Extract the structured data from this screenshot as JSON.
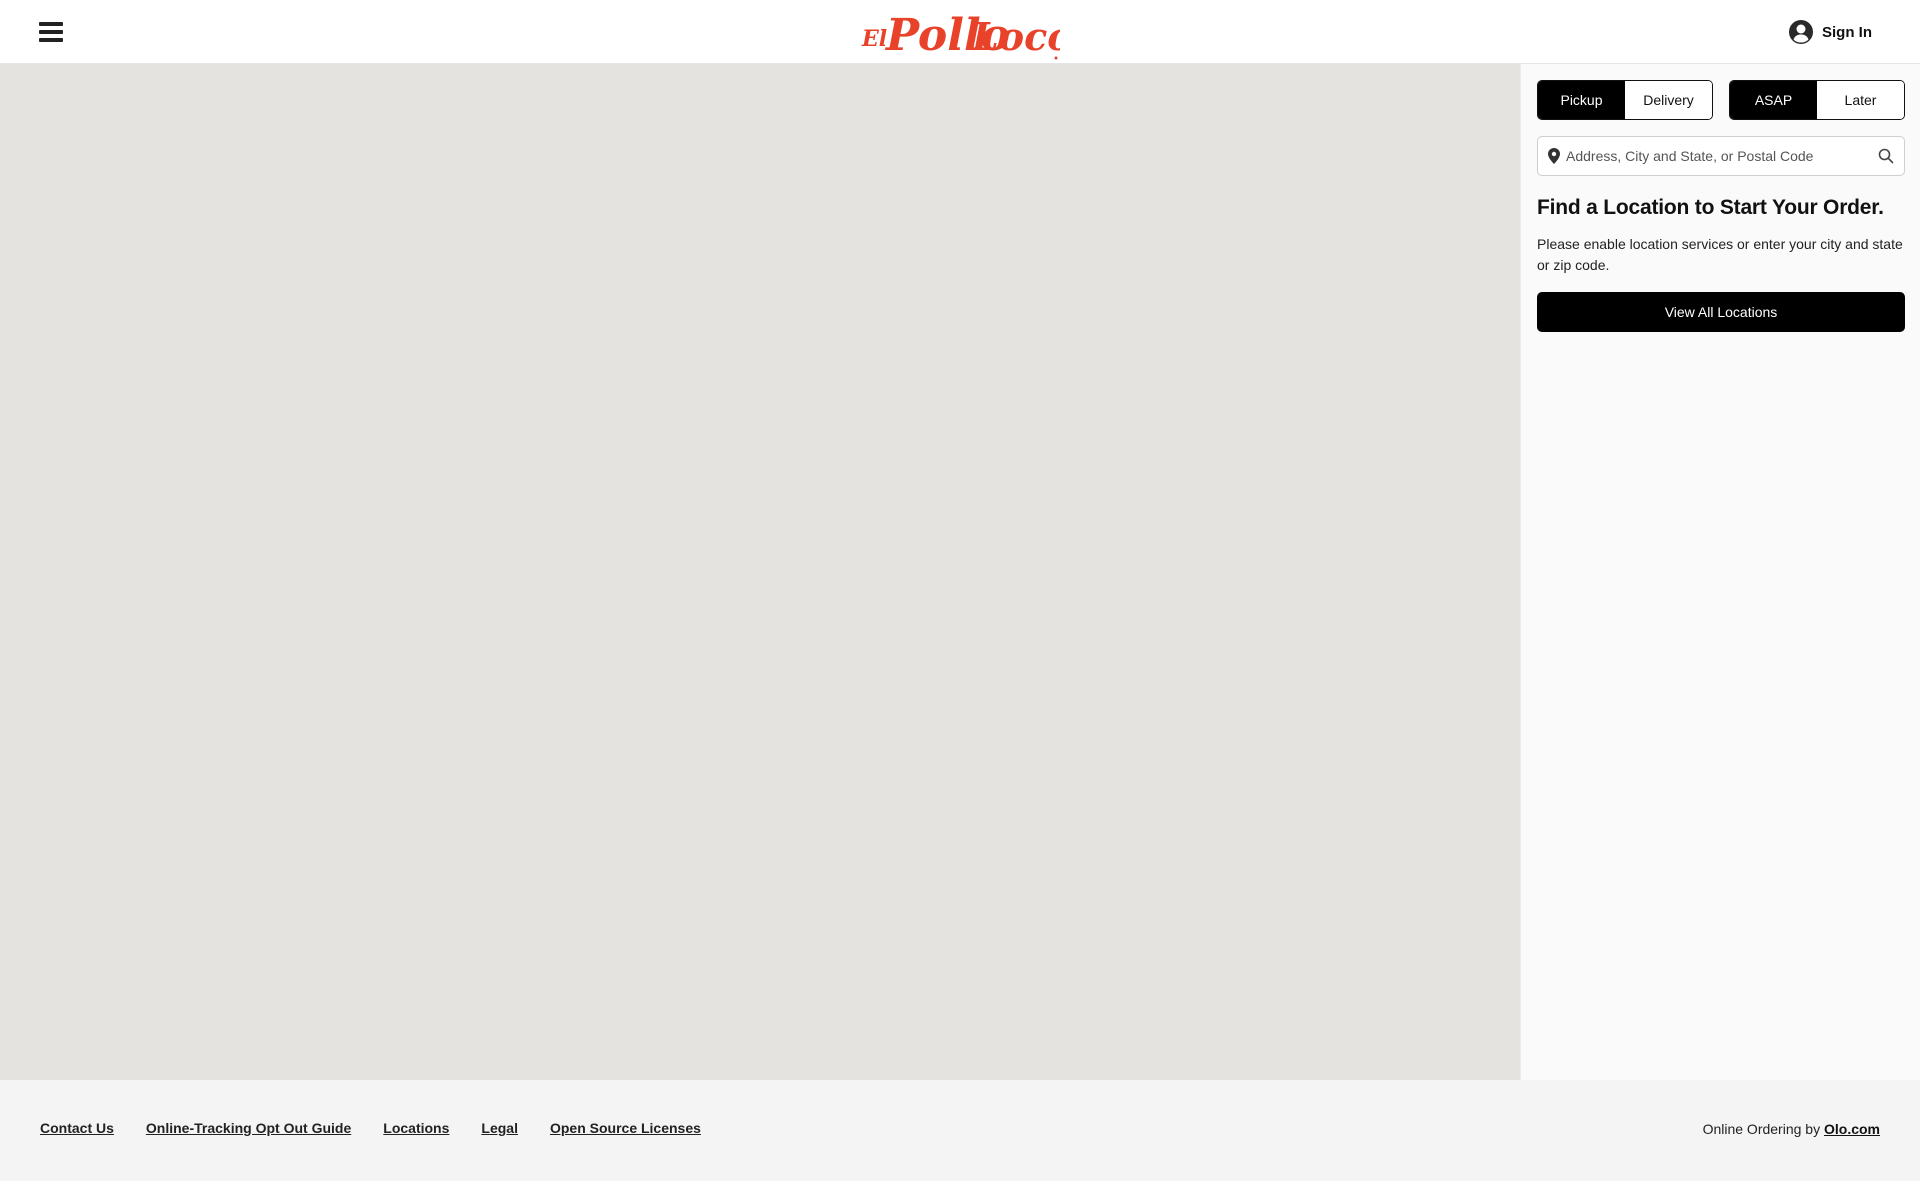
{
  "header": {
    "menu_icon": "hamburger-menu-icon",
    "logo_text": "El Pollo Loco",
    "signin_label": "Sign In",
    "signin_icon": "user-circle-icon"
  },
  "panel": {
    "mode_options": [
      {
        "label": "Pickup",
        "active": true
      },
      {
        "label": "Delivery",
        "active": false
      }
    ],
    "time_options": [
      {
        "label": "ASAP",
        "active": true
      },
      {
        "label": "Later",
        "active": false
      }
    ],
    "search": {
      "placeholder": "Address, City and State, or Postal Code",
      "value": "",
      "pin_icon": "location-pin-icon",
      "search_icon": "search-icon"
    },
    "heading": "Find a Location to Start Your Order.",
    "description": "Please enable location services or enter your city and state or zip code.",
    "view_all_label": "View All Locations"
  },
  "footer": {
    "links": [
      "Contact Us",
      "Online-Tracking Opt Out Guide",
      "Locations",
      "Legal",
      "Open Source Licenses"
    ],
    "powered_prefix": "Online Ordering by ",
    "powered_link": "Olo.com"
  },
  "colors": {
    "brand_red": "#e8432a",
    "map_bg": "#e5e3df",
    "panel_bg": "#fafafa",
    "footer_bg": "#f4f4f4",
    "accent_black": "#000000"
  }
}
